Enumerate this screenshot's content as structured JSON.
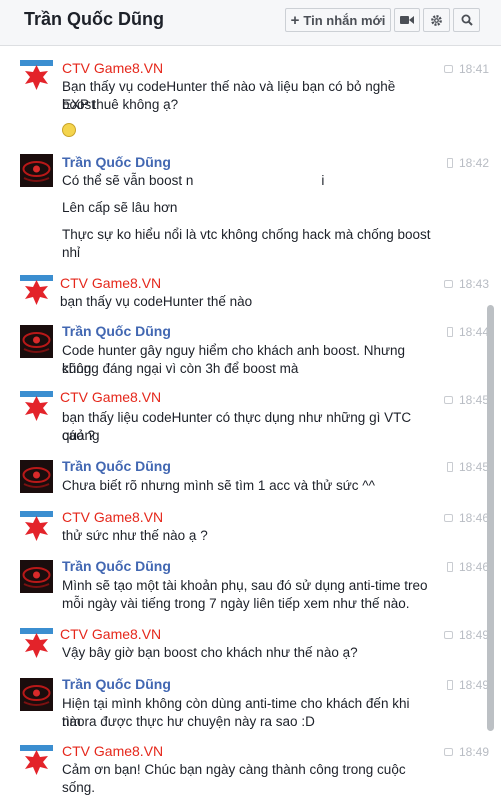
{
  "header": {
    "title": "Trần Quốc Dũng",
    "new_message_label": "Tin nhắn mới"
  },
  "messages": [
    {
      "sender": "CTV Game8.VN",
      "time": "18:41",
      "lines": [
        "Bạn thấy vụ codeHunter thế nào và liệu bạn có bỏ nghề boost",
        "EXP thuê không ạ?"
      ],
      "emoji": true
    },
    {
      "sender": "Trần Quốc Dũng",
      "time": "18:42",
      "lines": [
        "Có thể sẽ vẫn boost n",
        "i",
        "Lên cấp sẽ lâu hơn",
        "Thực sự ko hiểu nổi là vtc không chống hack mà chống boost",
        "nhỉ"
      ]
    },
    {
      "sender": "CTV Game8.VN",
      "time": "18:43",
      "lines": [
        "bạn thấy vụ codeHunter thế nào"
      ]
    },
    {
      "sender": "Trần Quốc Dũng",
      "time": "18:44",
      "lines": [
        "Code hunter gây nguy hiểm cho khách anh boost. Nhưng cũng",
        "không đáng ngại vì còn 3h để boost mà"
      ]
    },
    {
      "sender": "CTV Game8.VN",
      "time": "18:45",
      "lines": [
        "bạn thấy liệu codeHunter có thực dụng như những gì VTC quảng",
        "cáo ?"
      ]
    },
    {
      "sender": "Trần Quốc Dũng",
      "time": "18:45",
      "lines": [
        "Chưa biết rõ nhưng mình sẽ tìm 1 acc và thử sức ^^"
      ]
    },
    {
      "sender": "CTV Game8.VN",
      "time": "18:46",
      "lines": [
        "thử sức như thế nào ạ ?"
      ]
    },
    {
      "sender": "Trần Quốc Dũng",
      "time": "18:46",
      "lines": [
        "Mình sẽ tạo một tài khoản phụ, sau đó sử dụng anti-time treo",
        "mỗi ngày vài tiếng trong 7 ngày liên tiếp xem như thế nào."
      ]
    },
    {
      "sender": "CTV Game8.VN",
      "time": "18:49",
      "lines": [
        "Vậy bây giờ bạn boost cho khách như thế nào ạ?"
      ]
    },
    {
      "sender": "Trần Quốc Dũng",
      "time": "18:49",
      "lines": [
        "Hiện tại mình không còn dùng anti-time cho khách đến khi nào",
        "tìm ra được thực hư chuyện này ra sao :D"
      ]
    },
    {
      "sender": "CTV Game8.VN",
      "time": "18:49",
      "lines": [
        "Cảm ơn bạn! Chúc bạn ngày càng thành công trong cuộc sống."
      ]
    }
  ]
}
